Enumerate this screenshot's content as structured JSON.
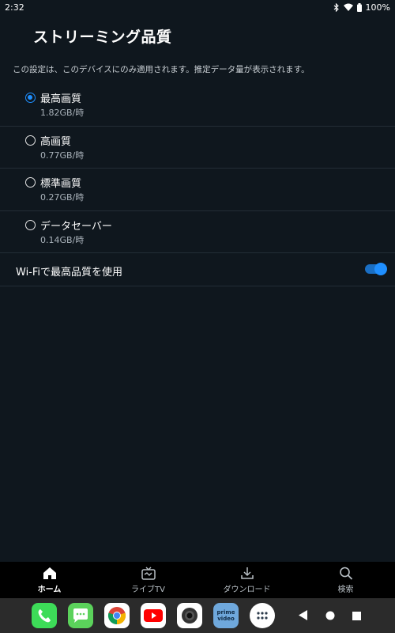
{
  "status_bar": {
    "time": "2:32",
    "battery": "100%"
  },
  "page": {
    "title": "ストリーミング品質",
    "description": "この設定は、このデバイスにのみ適用されます。推定データ量が表示されます。"
  },
  "options": [
    {
      "label": "最高画質",
      "sub": "1.82GB/時",
      "selected": true
    },
    {
      "label": "高画質",
      "sub": "0.77GB/時",
      "selected": false
    },
    {
      "label": "標準画質",
      "sub": "0.27GB/時",
      "selected": false
    },
    {
      "label": "データセーバー",
      "sub": "0.14GB/時",
      "selected": false
    }
  ],
  "wifi_setting": {
    "label": "Wi-Fiで最高品質を使用",
    "enabled": true
  },
  "bottom_nav": [
    {
      "label": "ホーム",
      "icon": "home-icon",
      "active": true
    },
    {
      "label": "ライブTV",
      "icon": "live-tv-icon",
      "active": false
    },
    {
      "label": "ダウンロード",
      "icon": "download-icon",
      "active": false
    },
    {
      "label": "検索",
      "icon": "search-icon",
      "active": false
    }
  ],
  "dock": {
    "apps": [
      "phone-app-icon",
      "messages-app-icon",
      "chrome-app-icon",
      "youtube-app-icon",
      "camera-app-icon",
      "prime-video-app-icon",
      "app-drawer-icon"
    ],
    "prime_video_label_line1": "prime",
    "prime_video_label_line2": "video"
  },
  "colors": {
    "background": "#0f171e",
    "accent": "#1f8fff",
    "nav_bg": "#000000",
    "dock_bg": "#2b2b2b"
  }
}
